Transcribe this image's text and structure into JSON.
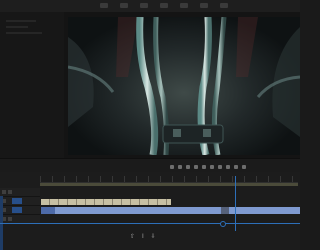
{
  "window": {
    "top_tabs": [
      "",
      "",
      "",
      "",
      "",
      "",
      "",
      "",
      ""
    ]
  },
  "monitor": {
    "timecode": "",
    "fit_label": ""
  },
  "timeline": {
    "clip_video_label": "",
    "clip_audio_label": "",
    "nav_buttons": [
      "⇧",
      "I",
      "⇩"
    ]
  },
  "colors": {
    "accent": "#2d6fb9",
    "video_clip": "#7f9ad0",
    "audio_clip": "#c7c0a4",
    "background": "#1a1a1a"
  }
}
